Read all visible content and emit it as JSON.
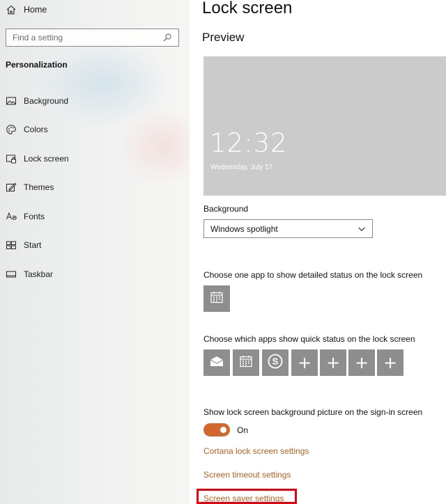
{
  "sidebar": {
    "home_label": "Home",
    "search_placeholder": "Find a setting",
    "section_title": "Personalization",
    "items": [
      {
        "label": "Background",
        "icon": "picture-icon"
      },
      {
        "label": "Colors",
        "icon": "palette-icon"
      },
      {
        "label": "Lock screen",
        "icon": "lock-screen-icon"
      },
      {
        "label": "Themes",
        "icon": "themes-icon"
      },
      {
        "label": "Fonts",
        "icon": "fonts-icon"
      },
      {
        "label": "Start",
        "icon": "start-icon"
      },
      {
        "label": "Taskbar",
        "icon": "taskbar-icon"
      }
    ]
  },
  "main": {
    "title": "Lock screen",
    "preview_heading": "Preview",
    "preview": {
      "time": "12:32",
      "date": "Wednesday, July 17"
    },
    "background_label": "Background",
    "background_value": "Windows spotlight",
    "detailed_status_label": "Choose one app to show detailed status on the lock screen",
    "quick_status_label": "Choose which apps show quick status on the lock screen",
    "quick_status_tiles": [
      "mail-icon",
      "calendar-icon",
      "skype-icon",
      "plus-icon",
      "plus-icon",
      "plus-icon",
      "plus-icon"
    ],
    "plus_glyph": "+",
    "signin_label": "Show lock screen background picture on the sign-in screen",
    "toggle_state": "On",
    "links": {
      "cortana": "Cortana lock screen settings",
      "timeout": "Screen timeout settings",
      "screensaver": "Screen saver settings"
    }
  },
  "colors": {
    "accent": "#d1692e",
    "link": "#b45f1e",
    "tile": "#8e8e8e",
    "preview": "#cbcbcb",
    "highlight": "#e3000f"
  }
}
